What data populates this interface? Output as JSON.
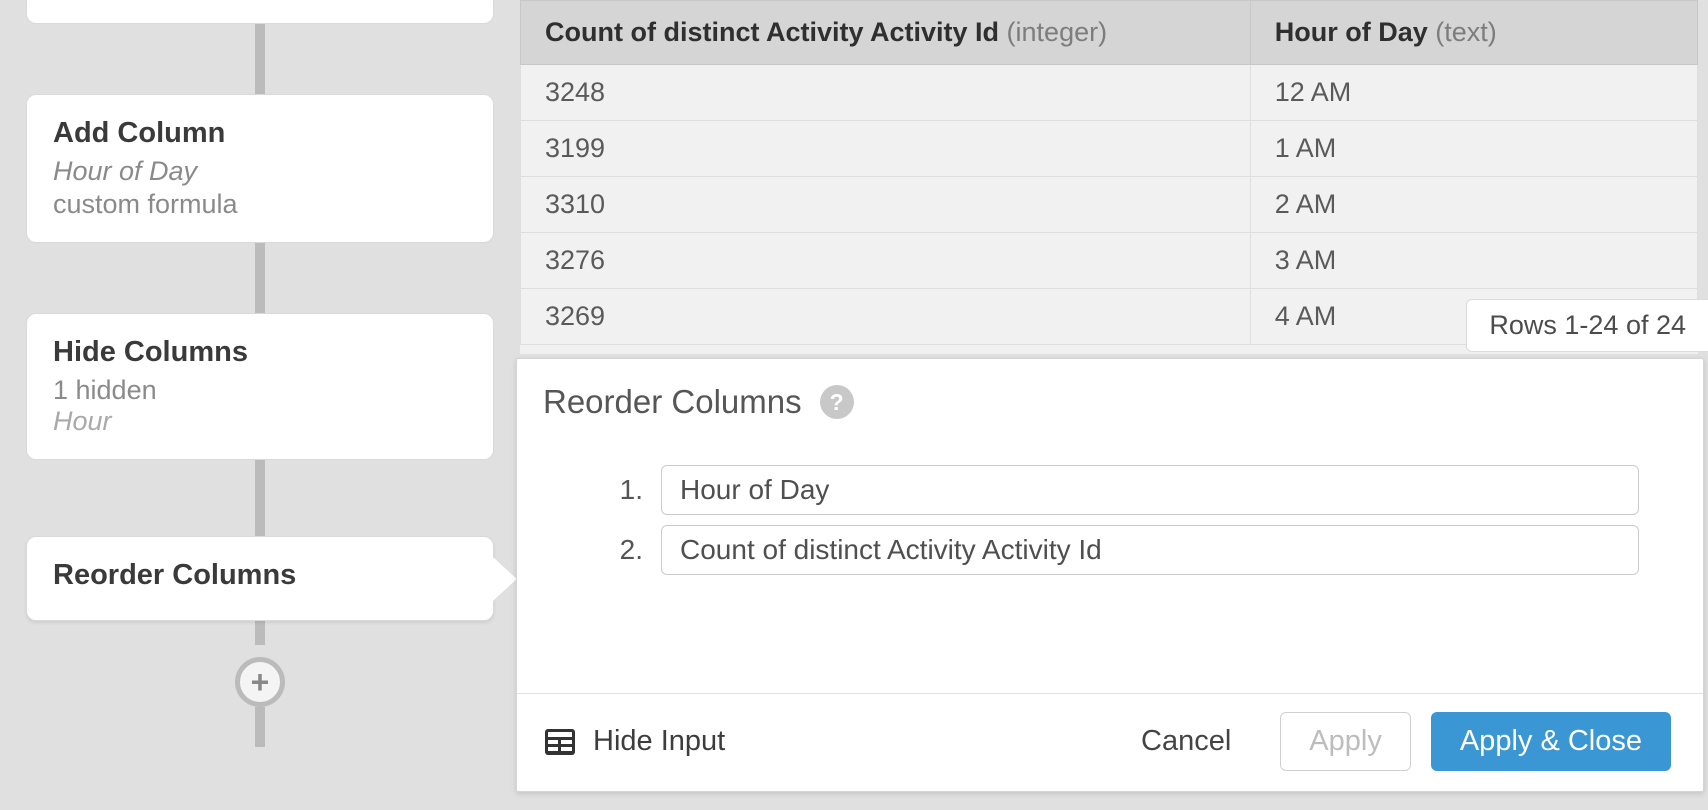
{
  "pipeline": {
    "addColumn": {
      "title": "Add Column",
      "line1": "Hour of Day",
      "line2": "custom formula"
    },
    "hideColumns": {
      "title": "Hide Columns",
      "line1": "1 hidden",
      "line2": "Hour"
    },
    "reorder": {
      "title": "Reorder Columns"
    },
    "addStepGlyph": "+"
  },
  "table": {
    "col1": {
      "name": "Count of distinct Activity Activity Id",
      "dtype": "(integer)"
    },
    "col2": {
      "name": "Hour of Day",
      "dtype": "(text)"
    },
    "rows": [
      {
        "c1": "3248",
        "c2": "12 AM"
      },
      {
        "c1": "3199",
        "c2": "1 AM"
      },
      {
        "c1": "3310",
        "c2": "2 AM"
      },
      {
        "c1": "3276",
        "c2": "3 AM"
      },
      {
        "c1": "3269",
        "c2": "4 AM"
      }
    ],
    "rowsBadge": "Rows 1-24 of 24"
  },
  "panel": {
    "title": "Reorder Columns",
    "helpGlyph": "?",
    "items": [
      {
        "idx": "1.",
        "label": "Hour of Day"
      },
      {
        "idx": "2.",
        "label": "Count of distinct Activity Activity Id"
      }
    ],
    "hideInput": "Hide Input",
    "cancel": "Cancel",
    "apply": "Apply",
    "applyClose": "Apply & Close"
  }
}
